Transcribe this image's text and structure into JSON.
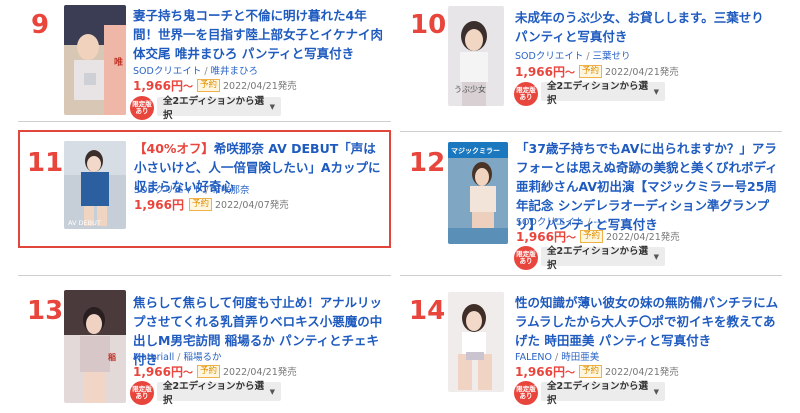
{
  "colors": {
    "accent": "#e8453c",
    "link": "#1f5bbf",
    "highlight": "#e0463c"
  },
  "items": [
    {
      "rank": "9",
      "sale": "",
      "title": "妻子持ち鬼コーチと不倫に明け暮れた4年間！世界一を目指す陸上部女子とイケナイ肉体交尾 唯井まひろ パンティと写真付き",
      "studio": "SODクリエイト",
      "actress": "唯井まひろ",
      "price": "1,966円",
      "tilde": "〜",
      "badge": "予約",
      "date": "2022/04/21発売",
      "limited": "限定版あり",
      "edition": "全2エディションから選択"
    },
    {
      "rank": "10",
      "sale": "",
      "title": "未成年のうぶ少女、お貸しします。三葉せり パンティと写真付き",
      "studio": "SODクリエイト",
      "actress": "三葉せり",
      "price": "1,966円",
      "tilde": "〜",
      "badge": "予約",
      "date": "2022/04/21発売",
      "limited": "限定版あり",
      "edition": "全2エディションから選択"
    },
    {
      "rank": "11",
      "sale": "【40%オフ】",
      "title": "希咲那奈 AV DEBUT「声は小さいけど、人一倍冒険したい」Aカップに収まらない好奇心",
      "studio": "SODクリエイト",
      "actress": "希咲那奈",
      "price": "1,966円",
      "tilde": "",
      "badge": "予約",
      "date": "2022/04/07発売",
      "limited": "",
      "edition": ""
    },
    {
      "rank": "12",
      "sale": "",
      "title": "「37歳子持ちでもAVに出られますか？」アラフォーとは思えぬ奇跡の美貌と美くびれボディ 亜莉紗さんAV初出演【マジックミラー号25周年記念 シンデレラオーディション準グランプリ】 パンティと写真付き",
      "studio": "SODクリエイト",
      "actress": "----",
      "price": "1,966円",
      "tilde": "〜",
      "badge": "予約",
      "date": "2022/04/21発売",
      "limited": "限定版あり",
      "edition": "全2エディションから選択"
    },
    {
      "rank": "13",
      "sale": "",
      "title": "焦らして焦らして何度も寸止め！アナルリップさせてくれる乳首弄りベロキス小悪魔の中出しM男宅訪問 稲場るか パンティとチェキ付き",
      "studio": "Materiall",
      "actress": "稲場るか",
      "price": "1,966円",
      "tilde": "〜",
      "badge": "予約",
      "date": "2022/04/21発売",
      "limited": "限定版あり",
      "edition": "全2エディションから選択"
    },
    {
      "rank": "14",
      "sale": "",
      "title": "性の知識が薄い彼女の妹の無防備パンチラにムラムラしたから大人チ〇ポで初イキを教えてあげた 時田亜美 パンティと写真付き",
      "studio": "FALENO",
      "actress": "時田亜美",
      "price": "1,966円",
      "tilde": "〜",
      "badge": "予約",
      "date": "2022/04/21発売",
      "limited": "限定版あり",
      "edition": "全2エディションから選択"
    }
  ],
  "covers": {
    "c9": "cover-photo-9",
    "c10": "うぶ少女",
    "c11": "AV DEBUT",
    "c12": "マジックミラー",
    "c13": "cover-photo-13",
    "c14": "cover-photo-14"
  }
}
